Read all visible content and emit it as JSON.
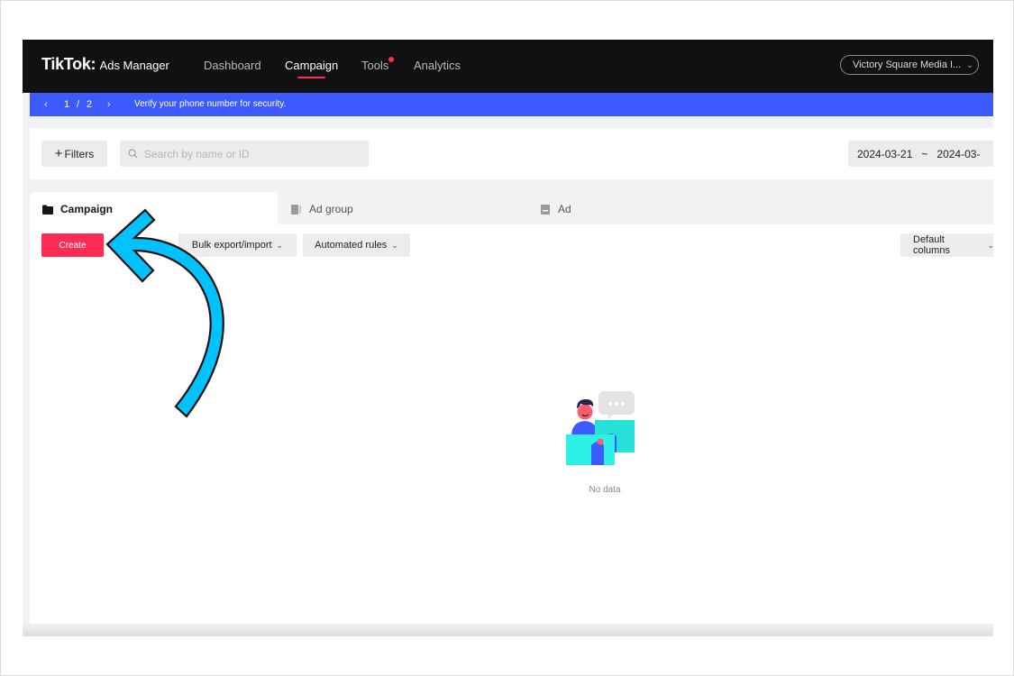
{
  "nav": {
    "logo_brand": "TikTok",
    "logo_separator": ":",
    "logo_product": "Ads Manager",
    "items": [
      {
        "label": "Dashboard"
      },
      {
        "label": "Campaign"
      },
      {
        "label": "Tools"
      },
      {
        "label": "Analytics"
      }
    ],
    "active_item": "Campaign",
    "account_label": "Victory Square Media I...",
    "accent_color": "#fe2c55"
  },
  "banner": {
    "current_page": "1",
    "separator": "/",
    "total_pages": "2",
    "message": "Verify your phone number for security.",
    "color": "#3d5afe"
  },
  "filters": {
    "filters_label": "Filters",
    "search_placeholder": "Search by name or ID",
    "date_start": "2024-03-21",
    "date_separator": "~",
    "date_end": "2024-03-"
  },
  "tabs": [
    {
      "label": "Campaign",
      "icon": "folder-icon"
    },
    {
      "label": "Ad group",
      "icon": "document-icon"
    },
    {
      "label": "Ad",
      "icon": "ad-icon"
    }
  ],
  "toolbar": {
    "create_label": "Create",
    "bulk_label": "Bulk export/import",
    "rules_label": "Automated rules",
    "columns_label": "Default columns"
  },
  "empty_state": {
    "text": "No data",
    "icon": "empty-illustration"
  },
  "annotation": {
    "icon": "curved-arrow-icon",
    "color": "#00c2ff"
  }
}
